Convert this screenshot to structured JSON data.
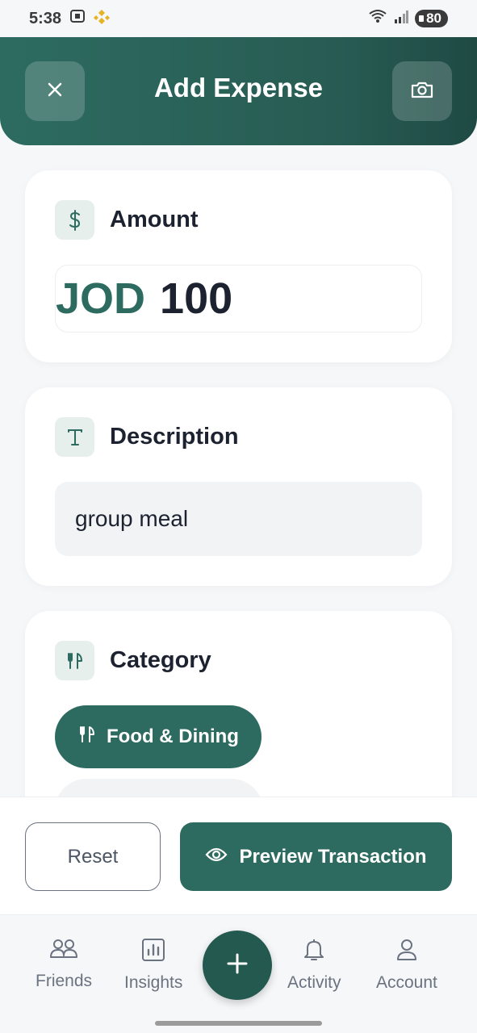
{
  "status_bar": {
    "time": "5:38",
    "battery": "80"
  },
  "header": {
    "title": "Add Expense"
  },
  "amount": {
    "label": "Amount",
    "currency": "JOD",
    "value": "100"
  },
  "description": {
    "label": "Description",
    "value": "group meal"
  },
  "category": {
    "label": "Category",
    "selected": "Food & Dining"
  },
  "actions": {
    "reset_label": "Reset",
    "preview_label": "Preview Transaction"
  },
  "nav": {
    "items": [
      {
        "label": "Friends"
      },
      {
        "label": "Insights"
      },
      {
        "label": "Activity"
      },
      {
        "label": "Account"
      }
    ]
  },
  "colors": {
    "brand": "#2d6b60",
    "header_dark": "#1f4a44",
    "fab": "#24594f"
  }
}
